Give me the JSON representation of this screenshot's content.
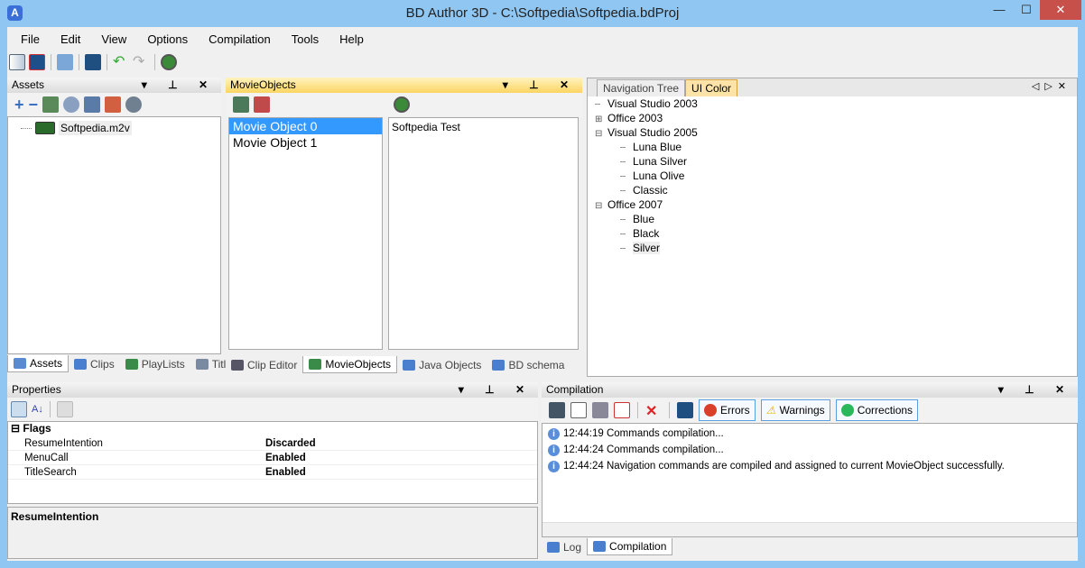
{
  "window": {
    "title": "BD Author 3D - C:\\Softpedia\\Softpedia.bdProj",
    "app_icon": "A",
    "minimize": "—",
    "maximize": "☐",
    "close": "✕"
  },
  "menu": [
    "File",
    "Edit",
    "View",
    "Options",
    "Compilation",
    "Tools",
    "Help"
  ],
  "assets": {
    "title": "Assets",
    "file": "Softpedia.m2v",
    "tabs": [
      "Assets",
      "Clips",
      "PlayLists",
      "Titles"
    ]
  },
  "movieobjects": {
    "title": "MovieObjects",
    "items": [
      "Movie Object 0",
      "Movie Object 1"
    ],
    "detail": "Softpedia Test",
    "tabs": [
      "Clip Editor",
      "MovieObjects",
      "Java Objects",
      "BD schema"
    ]
  },
  "nav": {
    "tabs": [
      "Navigation Tree",
      "UI Color"
    ],
    "tree": [
      {
        "label": "Visual Studio 2003",
        "level": 0,
        "exp": ""
      },
      {
        "label": "Office 2003",
        "level": 0,
        "exp": "+"
      },
      {
        "label": "Visual Studio 2005",
        "level": 0,
        "exp": "−"
      },
      {
        "label": "Luna Blue",
        "level": 1,
        "exp": ""
      },
      {
        "label": "Luna Silver",
        "level": 1,
        "exp": ""
      },
      {
        "label": "Luna Olive",
        "level": 1,
        "exp": ""
      },
      {
        "label": "Classic",
        "level": 1,
        "exp": ""
      },
      {
        "label": "Office 2007",
        "level": 0,
        "exp": "−"
      },
      {
        "label": "Blue",
        "level": 1,
        "exp": ""
      },
      {
        "label": "Black",
        "level": 1,
        "exp": ""
      },
      {
        "label": "Silver",
        "level": 1,
        "exp": ""
      }
    ]
  },
  "properties": {
    "title": "Properties",
    "category": "Flags",
    "rows": [
      {
        "name": "ResumeIntention",
        "value": "Discarded"
      },
      {
        "name": "MenuCall",
        "value": "Enabled"
      },
      {
        "name": "TitleSearch",
        "value": "Enabled"
      }
    ],
    "description": "ResumeIntention"
  },
  "compilation": {
    "title": "Compilation",
    "buttons": [
      "Errors",
      "Warnings",
      "Corrections"
    ],
    "log": [
      "12:44:19 Commands compilation...",
      "12:44:24 Commands compilation...",
      "12:44:24 Navigation commands are compiled and assigned to current MovieObject successfully."
    ],
    "tabs": [
      "Log",
      "Compilation"
    ]
  },
  "colors": {
    "accent": "#fbd561",
    "title_bar": "#8fc6f2",
    "selection": "#3399ff"
  }
}
